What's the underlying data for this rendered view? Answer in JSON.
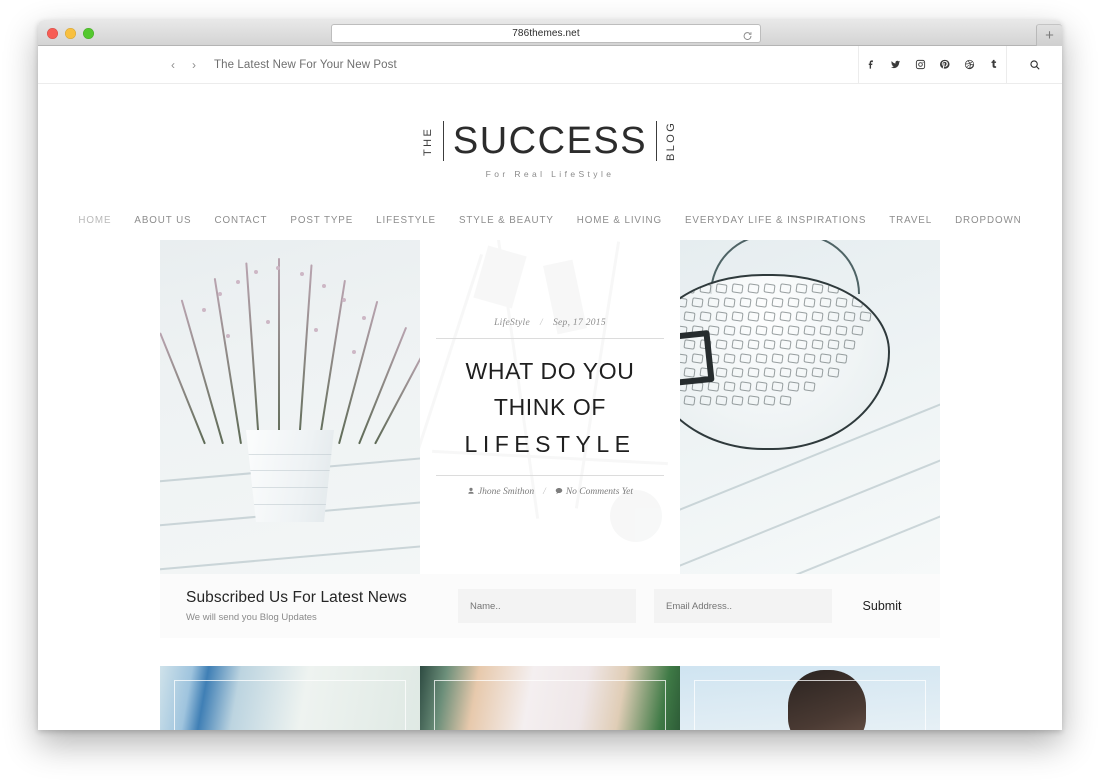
{
  "browser": {
    "url": "786themes.net",
    "reload_icon": "reload-icon",
    "newtab_label": "+",
    "traffic_lights": [
      "close",
      "minimize",
      "zoom"
    ]
  },
  "topbar": {
    "prev_arrow": "‹",
    "next_arrow": "›",
    "ticker": "The Latest New For Your New Post",
    "social": [
      {
        "name": "facebook",
        "label": "f"
      },
      {
        "name": "twitter",
        "label": "t"
      },
      {
        "name": "instagram",
        "label": "ig"
      },
      {
        "name": "pinterest",
        "label": "p"
      },
      {
        "name": "dribbble",
        "label": "d"
      },
      {
        "name": "tumblr",
        "label": "t"
      }
    ],
    "search_icon": "search-icon"
  },
  "logo": {
    "left": "THE",
    "main": "SUCCESS",
    "right": "BLOG",
    "tagline": "For Real LifeStyle"
  },
  "nav": {
    "items": [
      {
        "label": "HOME",
        "active": true
      },
      {
        "label": "ABOUT US",
        "active": false
      },
      {
        "label": "CONTACT",
        "active": false
      },
      {
        "label": "POST TYPE",
        "active": false
      },
      {
        "label": "LIFESTYLE",
        "active": false
      },
      {
        "label": "STYLE & BEAUTY",
        "active": false
      },
      {
        "label": "HOME & LIVING",
        "active": false
      },
      {
        "label": "EVERYDAY LIFE & INSPIRATIONS",
        "active": false
      },
      {
        "label": "TRAVEL",
        "active": false
      },
      {
        "label": "DROPDOWN",
        "active": false
      }
    ]
  },
  "hero": {
    "left_image_alt": "potted heather plant on white wooden table",
    "right_image_alt": "black wire mesh basket on white wooden table",
    "category": "LifeStyle",
    "separator": "/",
    "date": "Sep, 17 2015",
    "title_line1": "WHAT DO YOU",
    "title_line2": "THINK OF",
    "title_line3": "LIFESTYLE",
    "author": "Jhone Smithon",
    "comments": "No Comments Yet"
  },
  "newsletter": {
    "title": "Subscribed Us For Latest News",
    "subtitle": "We will send you Blog Updates",
    "name_placeholder": "Name..",
    "email_placeholder": "Email Address..",
    "submit_label": "Submit"
  },
  "posts": [
    {
      "alt": "woman in blue jeans and white knit sweater"
    },
    {
      "alt": "woman in white lace dress outdoors"
    },
    {
      "alt": "woman with dark hair against blue sky"
    }
  ],
  "colors": {
    "accent": "#2c2c2c",
    "muted": "#8d8d8d",
    "rule": "#dcdcdc",
    "panel": "#fbfbfb"
  }
}
